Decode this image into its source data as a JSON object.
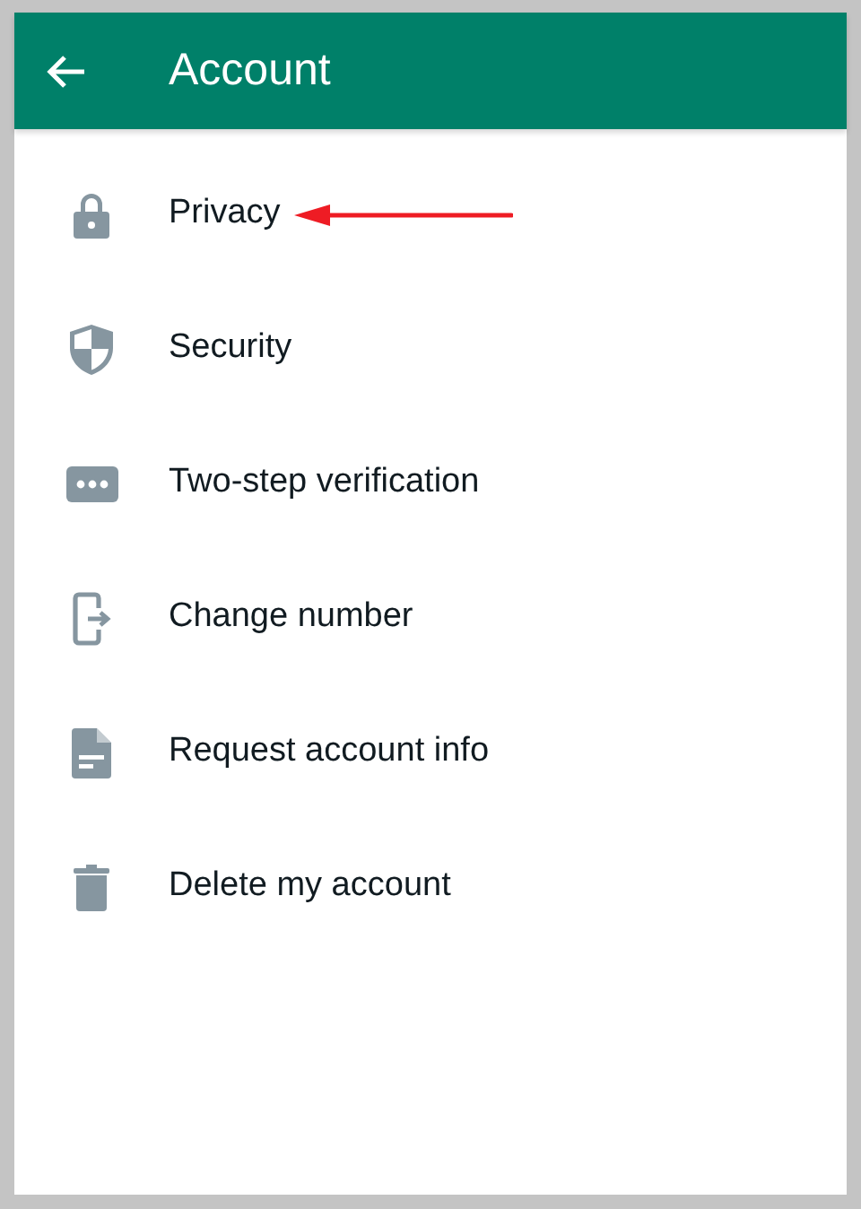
{
  "header": {
    "title": "Account"
  },
  "items": [
    {
      "label": "Privacy",
      "arrow": true
    },
    {
      "label": "Security",
      "arrow": false
    },
    {
      "label": "Two-step verification",
      "arrow": false
    },
    {
      "label": "Change number",
      "arrow": false
    },
    {
      "label": "Request account info",
      "arrow": false
    },
    {
      "label": "Delete my account",
      "arrow": false
    }
  ]
}
